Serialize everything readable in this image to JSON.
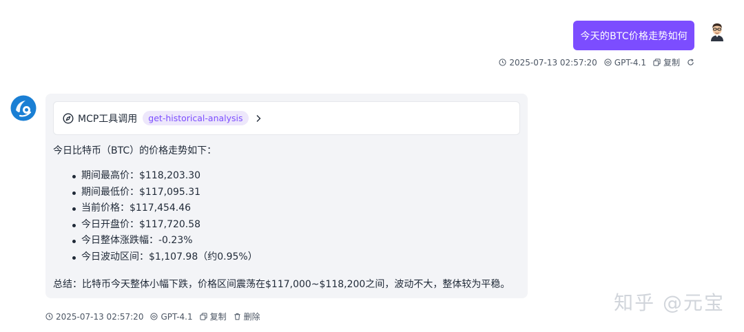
{
  "user_message": {
    "text": "今天的BTC价格走势如何",
    "timestamp": "2025-07-13 02:57:20",
    "model": "GPT-4.1",
    "copy_label": "复制"
  },
  "assistant_message": {
    "tool_call": {
      "label": "MCP工具调用",
      "tool_name": "get-historical-analysis"
    },
    "intro": "今日比特币（BTC）的价格走势如下：",
    "items": [
      "期间最高价：$118,203.30",
      "期间最低价：$117,095.31",
      "当前价格：$117,454.46",
      "今日开盘价：$117,720.58",
      "今日整体涨跌幅：-0.23%",
      "今日波动区间：$1,107.98（约0.95%）"
    ],
    "summary": "总结：比特币今天整体小幅下跌，价格区间震荡在$117,000~$118,200之间，波动不大，整体较为平稳。",
    "timestamp": "2025-07-13 02:57:20",
    "model": "GPT-4.1",
    "copy_label": "复制",
    "delete_label": "删除"
  },
  "watermark": "知乎 @元宝",
  "colors": {
    "accent": "#7c4dff",
    "tag_bg": "#ede7fb",
    "bubble_bg": "#f3f4f7",
    "bot_avatar": "#1a7fd4"
  },
  "icons": {
    "clock": "clock-icon",
    "model": "model-icon",
    "copy": "copy-icon",
    "refresh": "refresh-icon",
    "delete": "trash-icon",
    "tool": "compass-icon",
    "chevron": "chevron-right-icon"
  }
}
